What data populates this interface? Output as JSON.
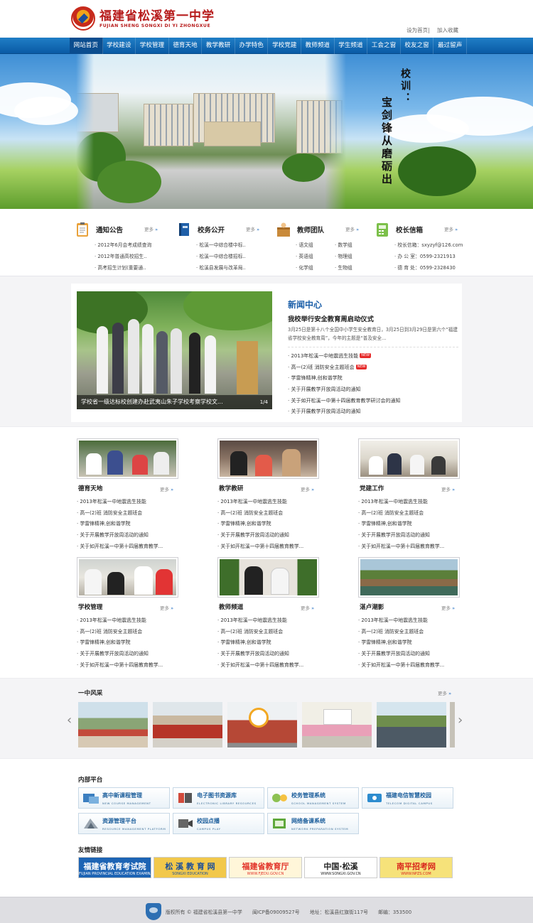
{
  "site": {
    "name_cn": "福建省松溪第一中学",
    "name_en": "FUJIAN SHENG SONGXI DI YI ZHONGXUE",
    "top_links": [
      "设为首页",
      "加入收藏"
    ]
  },
  "nav": [
    "网站首页",
    "学校建设",
    "学校管理",
    "德育天地",
    "教学教研",
    "办学特色",
    "学校党建",
    "教师频道",
    "学生频道",
    "工会之窗",
    "校友之窗",
    "最过留声"
  ],
  "banner": {
    "motto_head": "校训：",
    "motto_body": "宝剑锋从磨砺出"
  },
  "info_boxes": [
    {
      "title": "通知公告",
      "more": "更多",
      "icon": "notice-board-icon",
      "items": [
        "2012年6月会考成绩查询",
        "2012年普通高校招生..",
        "高考招生计划(重要通.."
      ]
    },
    {
      "title": "校务公开",
      "more": "更多",
      "icon": "book-icon",
      "items": [
        "松溪一中综合楼中标..",
        "松溪一中综合楼招标..",
        "松溪县发展与改革局.."
      ]
    },
    {
      "title": "教师团队",
      "more": "更多",
      "icon": "teacher-box-icon",
      "items": [
        "语文组",
        "数学组",
        "英语组",
        "物理组",
        "化学组",
        "生物组"
      ]
    },
    {
      "title": "校长信箱",
      "more": "更多",
      "icon": "mail-phone-icon",
      "items": [
        "校长信箱：sxyzyf@126.com",
        "办 公 室：0599-2321913",
        "德 育 处：0599-2328430"
      ]
    }
  ],
  "news": {
    "section_title": "新闻中心",
    "headline": "我校举行安全教育周启动仪式",
    "summary": "3月25日是第十八个全国中小学生安全教育日，3月25日到3月29日是第六个“福建省学校安全教育周”，今年的主题是“普及安全...",
    "slide_caption": "学校省一级达标校创建办赴武夷山朱子学校考察学校文...",
    "slide_page": "1/4",
    "new_badge": "NEW",
    "items": [
      "2013年松溪一中地震逃生技能",
      "高一(2)班 消防安全主题班会",
      "学雷锋精神,创和谐学院",
      "关于开展教学开放周活动的通知",
      "关于如开松溪一中第十四届教育教学研讨会的通知",
      "关于开展教学开放周活动的通知"
    ]
  },
  "columns": [
    {
      "title": "德育天地",
      "more": "更多",
      "items": [
        "2013年松溪一中地震逃生技能",
        "高一(2)班 消防安全主题班会",
        "学雷锋精神,创和谐学院",
        "关于开展教学开放周活动的通知",
        "关于如开松溪一中第十四届教育教学..."
      ]
    },
    {
      "title": "教学教研",
      "more": "更多",
      "items": [
        "2013年松溪一中地震逃生技能",
        "高一(2)班 消防安全主题班会",
        "学雷锋精神,创和谐学院",
        "关于开展教学开放周活动的通知",
        "关于如开松溪一中第十四届教育教学..."
      ]
    },
    {
      "title": "党建工作",
      "more": "更多",
      "items": [
        "2013年松溪一中地震逃生技能",
        "高一(2)班 消防安全主题班会",
        "学雷锋精神,创和谐学院",
        "关于开展教学开放周活动的通知",
        "关于如开松溪一中第十四届教育教学..."
      ]
    },
    {
      "title": "学校管理",
      "more": "更多",
      "items": [
        "2013年松溪一中地震逃生技能",
        "高一(2)班 消防安全主题班会",
        "学雷锋精神,创和谐学院",
        "关于开展教学开放周活动的通知",
        "关于如开松溪一中第十四届教育教学..."
      ]
    },
    {
      "title": "教师频道",
      "more": "更多",
      "items": [
        "2013年松溪一中地震逃生技能",
        "高一(2)班 消防安全主题班会",
        "学雷锋精神,创和谐学院",
        "关于开展教学开放周活动的通知",
        "关于如开松溪一中第十四届教育教学..."
      ]
    },
    {
      "title": "湛卢潮影",
      "more": "更多",
      "items": [
        "2013年松溪一中地震逃生技能",
        "高一(2)班 消防安全主题班会",
        "学雷锋精神,创和谐学院",
        "关于开展教学开放周活动的通知",
        "关于如开松溪一中第十四届教育教学..."
      ]
    }
  ],
  "gallery": {
    "title": "一中风采",
    "more": "更多",
    "prev_icon": "‹",
    "next_icon": "›"
  },
  "platforms": {
    "title": "内部平台",
    "items": [
      {
        "cn": "高中新课程管理",
        "en": "NEW COURSE MANAGEMENT"
      },
      {
        "cn": "电子图书资源库",
        "en": "ELECTRONIC LIBRARY RESOURCES"
      },
      {
        "cn": "校务管理系统",
        "en": "SCHOOL MANAGEMENT SYSTEM"
      },
      {
        "cn": "福建电信智慧校园",
        "en": "TELECOM DIGITAL CAMPUS"
      },
      {
        "cn": "资源管理平台",
        "en": "RESOURCE MANAGEMENT PLATFORM"
      },
      {
        "cn": "校园点播",
        "en": "CAMPUS PLAY"
      },
      {
        "cn": "网络备课系统",
        "en": "NETWORK PREPARATION SYSTEM"
      }
    ]
  },
  "links": {
    "title": "友情链接",
    "items": [
      {
        "cn": "福建省教育考试院",
        "en": "FUJIAN PROVINCIAL EDUCATION EXAMINATIONS AUTHORITY",
        "color": "#ffffff",
        "bg": "#1d64b4"
      },
      {
        "cn": "松 溪 教 育 网",
        "en": "SONGXI EDUCATION",
        "color": "#1c4f9a",
        "bg": "#f2c84b"
      },
      {
        "cn": "福建省教育厅",
        "en": "WWW.FJEDU.GOV.CN",
        "color": "#e2342a",
        "bg": "#fff6d9"
      },
      {
        "cn": "中国·松溪",
        "en": "WWW.SONGXI.GOV.CN",
        "color": "#222222",
        "bg": "#ffffff"
      },
      {
        "cn": "南平招考网",
        "en": "WWW.NPZS.COM",
        "color": "#d9261c",
        "bg": "#f6e27a"
      }
    ]
  },
  "footer": {
    "copyright": "版权所有 © 福建省松溪县第一中学",
    "icp": "闽ICP备09009527号",
    "address": "地址：松溪县红旗街117号",
    "postcode": "邮编：353500"
  }
}
